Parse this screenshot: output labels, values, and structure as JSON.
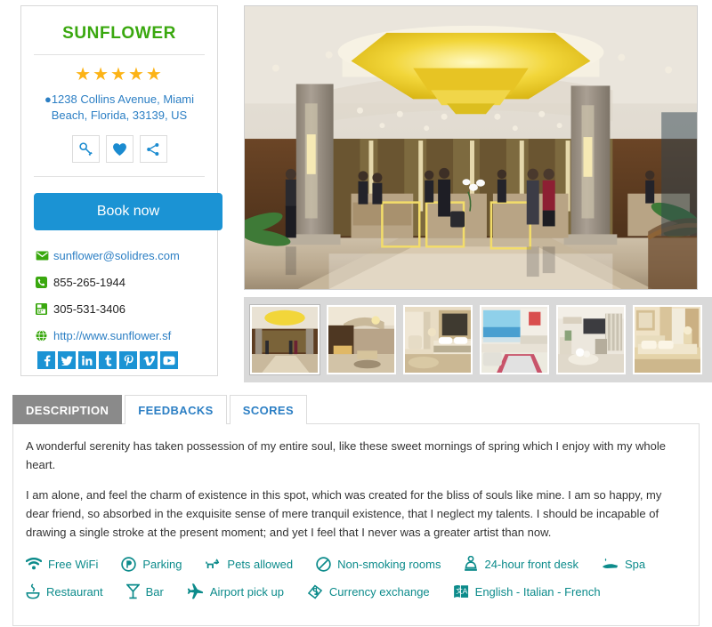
{
  "hotel": {
    "name": "SUNFLOWER",
    "rating_stars": 5,
    "star_glyph": "★",
    "address": "1238 Collins Avenue, Miami Beach, Florida, 33139, US",
    "pin_icon": "map-pin-icon"
  },
  "actions": [
    {
      "name": "key-icon",
      "title": "Key"
    },
    {
      "name": "heart-icon",
      "title": "Favorite"
    },
    {
      "name": "share-icon",
      "title": "Share"
    }
  ],
  "book": {
    "label": "Book now"
  },
  "contact": {
    "email": "sunflower@solidres.com",
    "phone": "855-265-1944",
    "fax": "305-531-3406",
    "website": "http://www.sunflower.sf",
    "email_icon": "envelope-icon",
    "phone_icon": "phone-icon",
    "fax_icon": "fax-icon",
    "website_icon": "globe-icon"
  },
  "social": [
    {
      "name": "facebook-icon",
      "label": "f"
    },
    {
      "name": "twitter-icon",
      "label": "t"
    },
    {
      "name": "linkedin-icon",
      "label": "in"
    },
    {
      "name": "tumblr-icon",
      "label": "t"
    },
    {
      "name": "pinterest-icon",
      "label": "p"
    },
    {
      "name": "vimeo-icon",
      "label": "v"
    },
    {
      "name": "youtube-icon",
      "label": "You"
    }
  ],
  "gallery": {
    "main_alt": "hotel-lobby-with-gold-chandelier",
    "thumbnails": [
      "hotel-lobby",
      "lobby-lounge-staircase",
      "bedroom-beige",
      "ocean-view-suite",
      "living-room-tv",
      "bedroom-classic"
    ],
    "active_thumbnail_index": 0
  },
  "tabs": [
    {
      "label": "DESCRIPTION",
      "active": true
    },
    {
      "label": "FEEDBACKS",
      "active": false
    },
    {
      "label": "SCORES",
      "active": false
    }
  ],
  "description": {
    "paragraph_1": "A wonderful serenity has taken possession of my entire soul, like these sweet mornings of spring which I enjoy with my whole heart.",
    "paragraph_2": "I am alone, and feel the charm of existence in this spot, which was created for the bliss of souls like mine. I am so happy, my dear friend, so absorbed in the exquisite sense of mere tranquil existence, that I neglect my talents. I should be incapable of drawing a single stroke at the present moment; and yet I feel that I never was a greater artist than now."
  },
  "amenities": {
    "row1": [
      {
        "label": "Free WiFi",
        "icon": "wifi-icon"
      },
      {
        "label": "Parking",
        "icon": "parking-icon"
      },
      {
        "label": "Pets allowed",
        "icon": "pets-icon"
      },
      {
        "label": "Non-smoking rooms",
        "icon": "no-smoking-icon"
      },
      {
        "label": "24-hour front desk",
        "icon": "front-desk-icon"
      },
      {
        "label": "Spa",
        "icon": "spa-icon"
      }
    ],
    "row2": [
      {
        "label": "Restaurant",
        "icon": "restaurant-icon"
      },
      {
        "label": "Bar",
        "icon": "bar-icon"
      },
      {
        "label": "Airport pick up",
        "icon": "airplane-icon"
      },
      {
        "label": "Currency exchange",
        "icon": "currency-icon"
      },
      {
        "label": "English - Italian - French",
        "icon": "languages-icon"
      }
    ]
  },
  "colors": {
    "brand_green": "#3aa80f",
    "link_blue": "#2c7fc4",
    "button_blue": "#1b93d4",
    "star_gold": "#fcb316",
    "amenity_teal": "#0c8b8b",
    "active_tab_gray": "#8a8a8a",
    "contact_icon_green": "#3aa80f"
  }
}
